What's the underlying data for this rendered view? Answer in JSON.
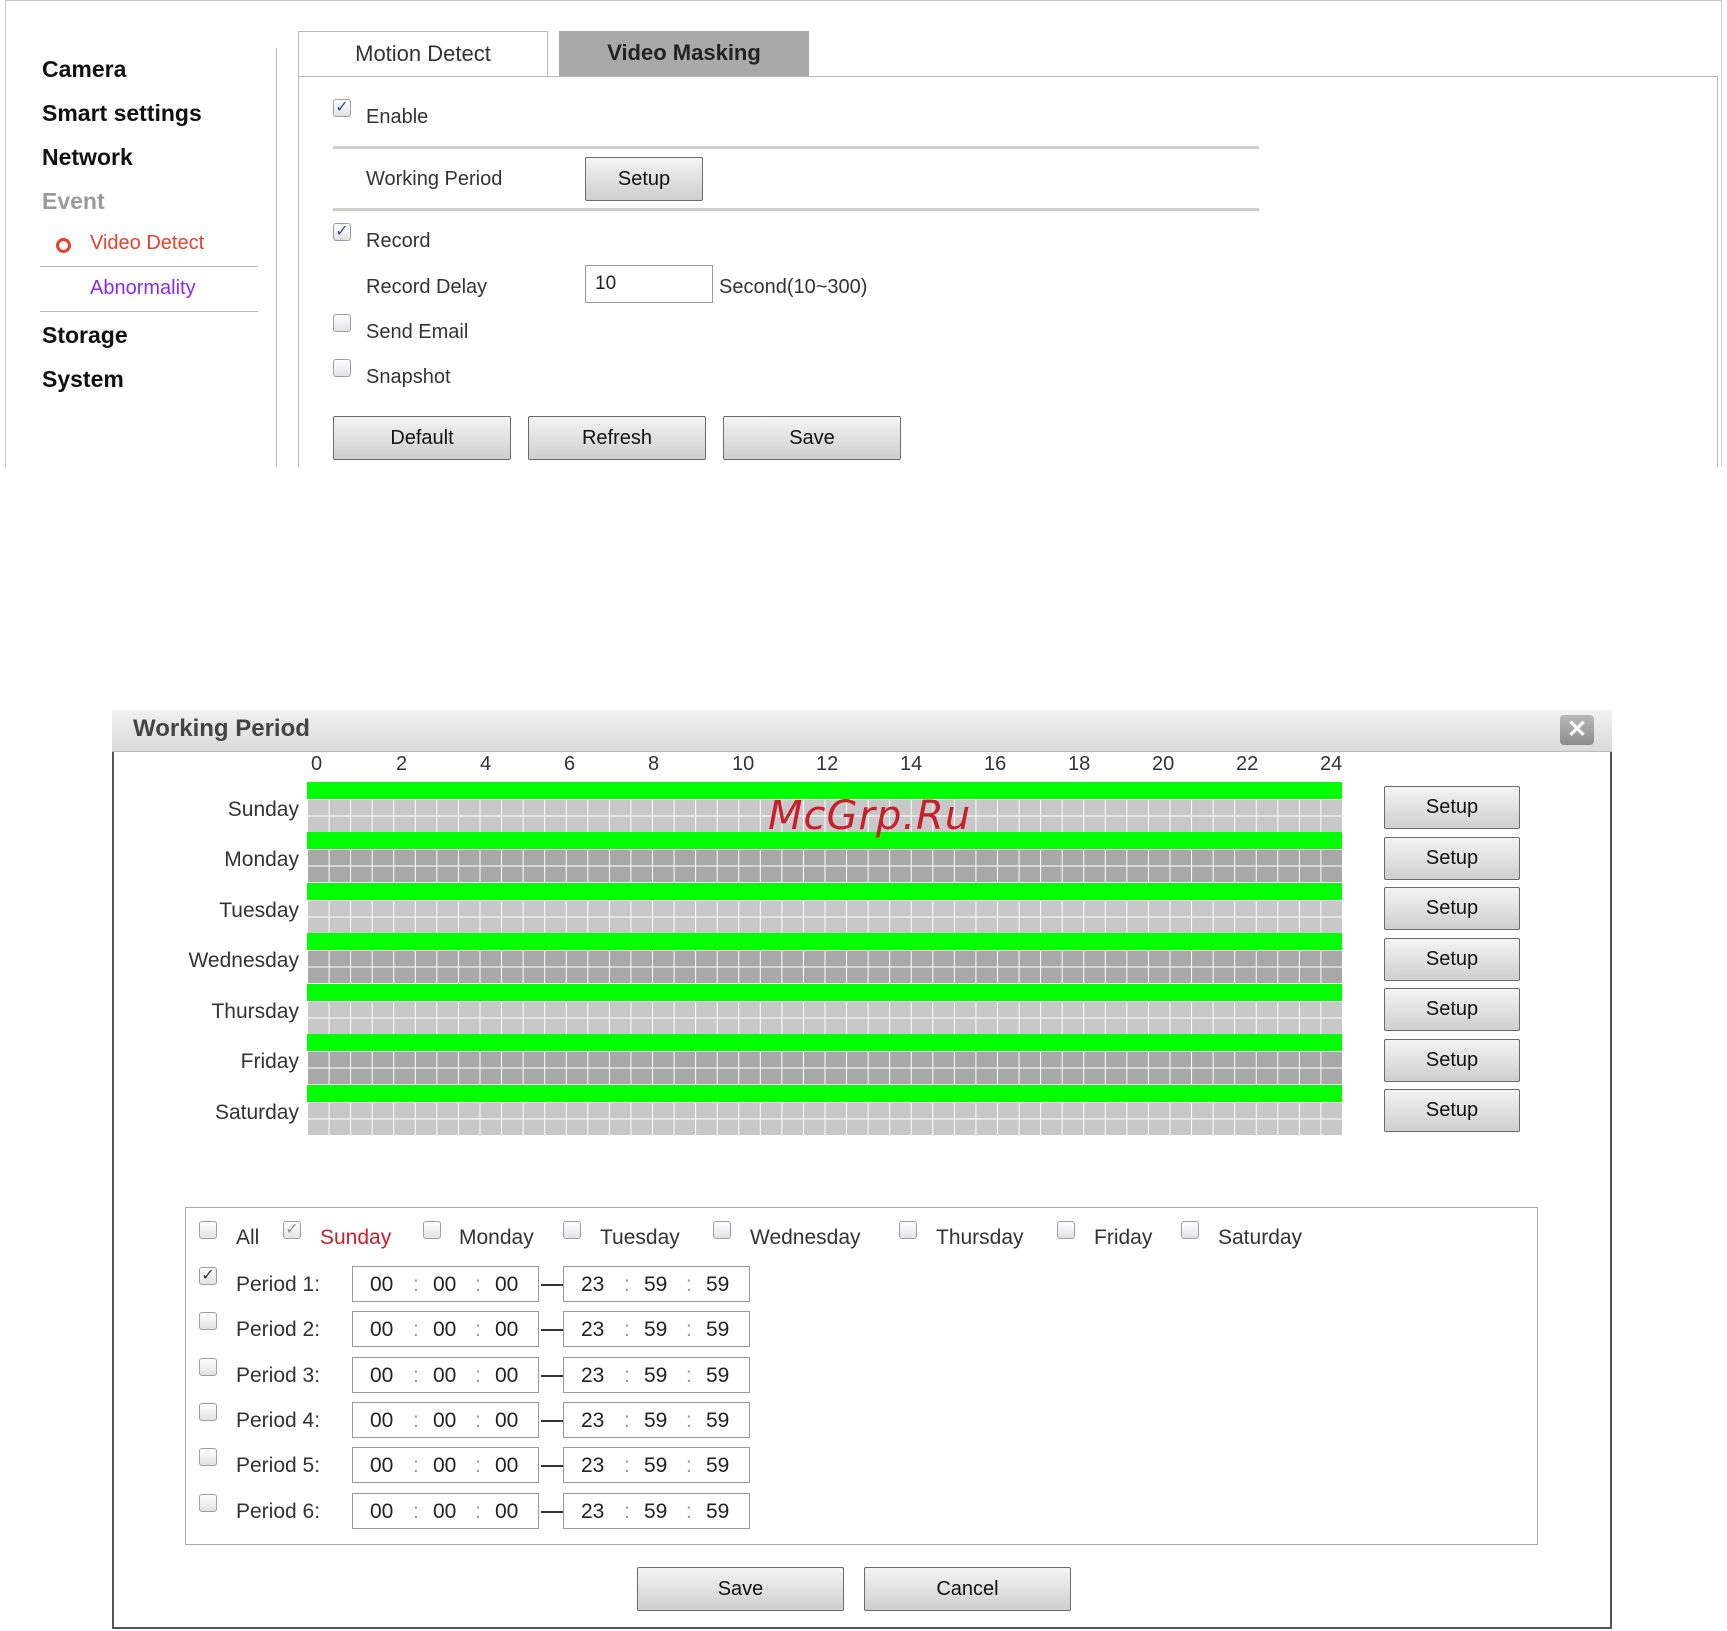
{
  "sidebar": {
    "items": [
      "Camera",
      "Smart settings",
      "Network",
      "Event",
      "Storage",
      "System"
    ],
    "sub_items": [
      "Video Detect",
      "Abnormality"
    ]
  },
  "tabs": [
    "Motion Detect",
    "Video Masking"
  ],
  "form": {
    "enable_label": "Enable",
    "working_period_label": "Working Period",
    "setup_label": "Setup",
    "record_label": "Record",
    "record_delay_label": "Record Delay",
    "record_delay_value": "10",
    "record_delay_unit": "Second(10~300)",
    "send_email_label": "Send Email",
    "snapshot_label": "Snapshot",
    "default_label": "Default",
    "refresh_label": "Refresh",
    "save_label": "Save"
  },
  "dialog": {
    "title": "Working Period",
    "close_glyph": "✕",
    "hours": [
      "0",
      "2",
      "4",
      "6",
      "8",
      "10",
      "12",
      "14",
      "16",
      "18",
      "20",
      "22",
      "24"
    ],
    "days": [
      "Sunday",
      "Monday",
      "Tuesday",
      "Wednesday",
      "Thursday",
      "Friday",
      "Saturday"
    ],
    "setup_label": "Setup",
    "watermark": "McGrp.Ru",
    "day_checks": {
      "all": "All",
      "sunday": "Sunday",
      "monday": "Monday",
      "tuesday": "Tuesday",
      "wednesday": "Wednesday",
      "thursday": "Thursday",
      "friday": "Friday",
      "saturday": "Saturday"
    },
    "periods": [
      {
        "label": "Period 1:",
        "start": [
          "00",
          "00",
          "00"
        ],
        "end": [
          "23",
          "59",
          "59"
        ],
        "checked": true
      },
      {
        "label": "Period 2:",
        "start": [
          "00",
          "00",
          "00"
        ],
        "end": [
          "23",
          "59",
          "59"
        ],
        "checked": false
      },
      {
        "label": "Period 3:",
        "start": [
          "00",
          "00",
          "00"
        ],
        "end": [
          "23",
          "59",
          "59"
        ],
        "checked": false
      },
      {
        "label": "Period 4:",
        "start": [
          "00",
          "00",
          "00"
        ],
        "end": [
          "23",
          "59",
          "59"
        ],
        "checked": false
      },
      {
        "label": "Period 5:",
        "start": [
          "00",
          "00",
          "00"
        ],
        "end": [
          "23",
          "59",
          "59"
        ],
        "checked": false
      },
      {
        "label": "Period 6:",
        "start": [
          "00",
          "00",
          "00"
        ],
        "end": [
          "23",
          "59",
          "59"
        ],
        "checked": false
      }
    ],
    "save_label": "Save",
    "cancel_label": "Cancel"
  },
  "colors": {
    "active_bar": "#00ff00",
    "selected_day": "#c8202a",
    "sub_link": "#8a2be2",
    "bullet": "#e8402a"
  }
}
